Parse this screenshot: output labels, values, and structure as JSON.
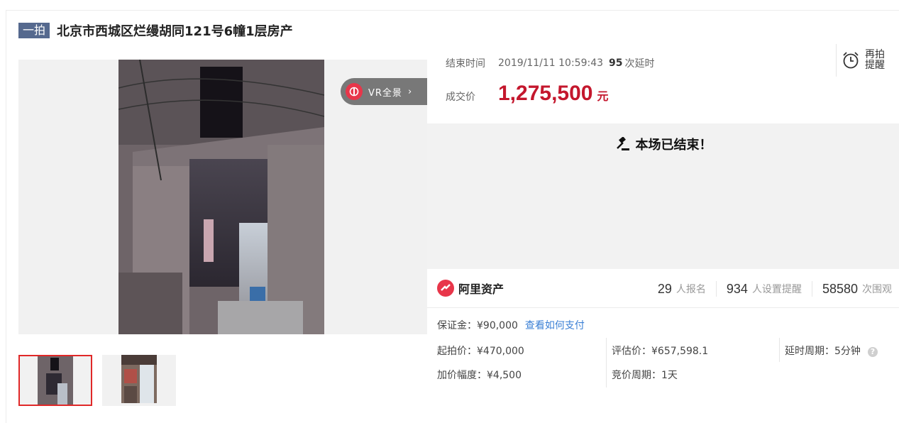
{
  "listing": {
    "tag": "一拍",
    "title": "北京市西城区烂缦胡同121号6幢1层房产"
  },
  "gallery": {
    "vr_label": "VR全景",
    "vr_arrow": "›"
  },
  "auction": {
    "end_label": "结束时间",
    "end_time": "2019/11/11 10:59:43",
    "delay_count": "95",
    "delay_suffix": "次延时",
    "remind_line1": "再拍",
    "remind_line2": "提醒",
    "price_label": "成交价",
    "price": "1,275,500",
    "price_unit": "元",
    "ended_text": "本场已结束！"
  },
  "stats": {
    "brand": "阿里资产",
    "signups": "29",
    "signups_label": "人报名",
    "reminders": "934",
    "reminders_label": "人设置提醒",
    "views": "58580",
    "views_label": "次围观"
  },
  "details": {
    "deposit": "保证金：¥90,000",
    "deposit_link": "查看如何支付",
    "start_price": "起拍价：¥470,000",
    "appraisal": "评估价：¥657,598.1",
    "delay_period": "延时周期：5分钟",
    "increment": "加价幅度：¥4,500",
    "bid_period": "竞价周期：1天"
  },
  "colors": {
    "price_red": "#c4172d",
    "tag_bg": "#55698e",
    "link_blue": "#3a7fd5",
    "brand_red": "#e8364a"
  }
}
